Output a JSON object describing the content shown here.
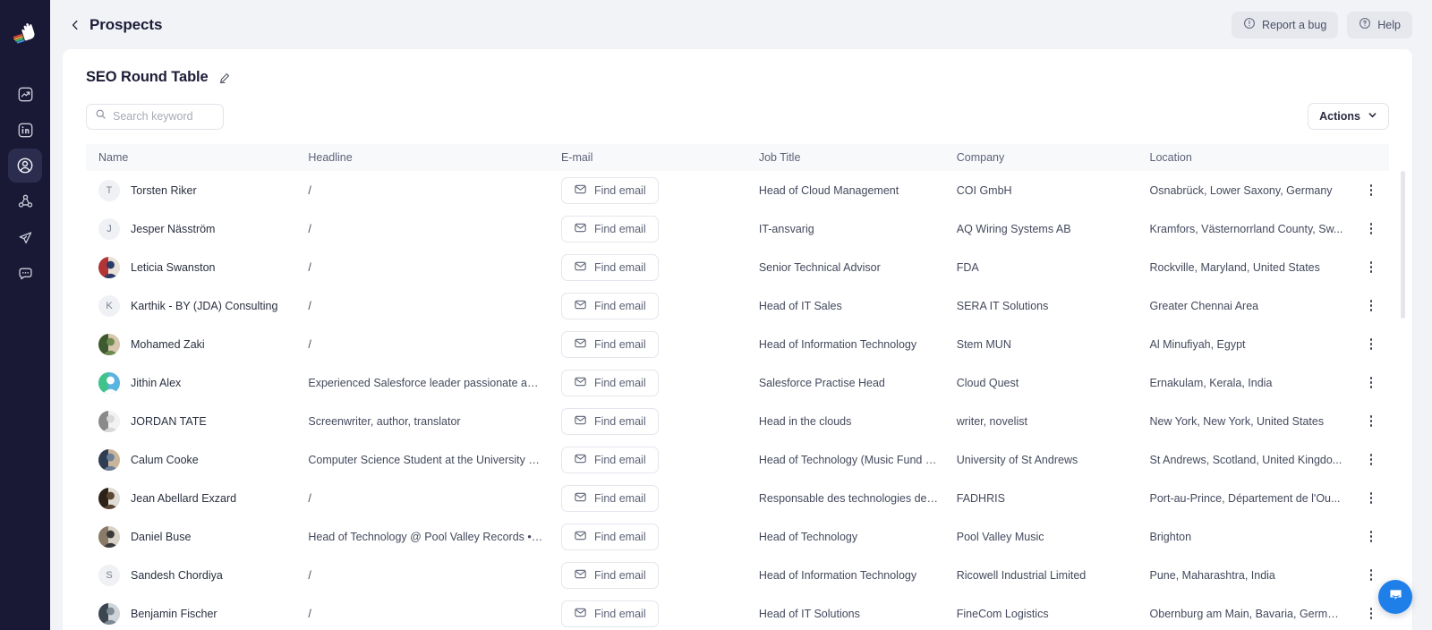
{
  "sidebar": {
    "logo_name": "hand-logo",
    "items": [
      {
        "name": "analytics",
        "icon": "trending-chart-icon",
        "active": false
      },
      {
        "name": "linkedin",
        "icon": "linkedin-icon",
        "active": false
      },
      {
        "name": "prospects",
        "icon": "user-circle-icon",
        "active": true
      },
      {
        "name": "network",
        "icon": "share-network-icon",
        "active": false
      },
      {
        "name": "campaigns",
        "icon": "paper-plane-icon",
        "active": false
      },
      {
        "name": "messages",
        "icon": "chat-bubble-icon",
        "active": false
      }
    ]
  },
  "topbar": {
    "back_label": "‹",
    "title": "Prospects",
    "report_bug_label": "Report a bug",
    "help_label": "Help"
  },
  "list": {
    "title": "SEO Round Table",
    "edit_tooltip": "Edit"
  },
  "search": {
    "placeholder": "Search keyword",
    "value": ""
  },
  "actions": {
    "label": "Actions",
    "caret": "▾"
  },
  "table": {
    "columns": [
      "Name",
      "Headline",
      "E-mail",
      "Job Title",
      "Company",
      "Location"
    ],
    "find_email_label": "Find email",
    "rows": [
      {
        "name": "Torsten Riker",
        "avatar_type": "initial",
        "initial": "T",
        "headline": "/",
        "email_action": "Find email",
        "job_title": "Head of Cloud Management",
        "company": "COI GmbH",
        "location": "Osnabrück, Lower Saxony, Germany"
      },
      {
        "name": "Jesper Näsström",
        "avatar_type": "initial",
        "initial": "J",
        "headline": "/",
        "email_action": "Find email",
        "job_title": "IT-ansvarig",
        "company": "AQ Wiring Systems AB",
        "location": "Kramfors, Västernorrland County, Sw..."
      },
      {
        "name": "Leticia Swanston",
        "avatar_type": "photo",
        "photo_colors": [
          "#2b3a66",
          "#b33434",
          "#e8e2d8"
        ],
        "headline": "/",
        "email_action": "Find email",
        "job_title": "Senior Technical Advisor",
        "company": "FDA",
        "location": "Rockville, Maryland, United States"
      },
      {
        "name": "Karthik - BY (JDA) Consulting",
        "avatar_type": "initial",
        "initial": "K",
        "headline": "/",
        "email_action": "Find email",
        "job_title": "Head of IT Sales",
        "company": "SERA IT Solutions",
        "location": "Greater Chennai Area"
      },
      {
        "name": "Mohamed Zaki",
        "avatar_type": "photo",
        "photo_colors": [
          "#6d8a4f",
          "#3d5a2e",
          "#d8c7ae"
        ],
        "headline": "/",
        "email_action": "Find email",
        "job_title": "Head of Information Technology",
        "company": "Stem MUN",
        "location": "Al Minufiyah, Egypt"
      },
      {
        "name": "Jithin Alex",
        "avatar_type": "photo",
        "photo_colors": [
          "#ffffff",
          "#3fc38a",
          "#5ab4e0"
        ],
        "headline": "Experienced Salesforce leader passionate about...",
        "email_action": "Find email",
        "job_title": "Salesforce Practise Head",
        "company": "Cloud Quest",
        "location": "Ernakulam, Kerala, India"
      },
      {
        "name": "JORDAN TATE",
        "avatar_type": "photo",
        "photo_colors": [
          "#d8d8d8",
          "#8a8a8a",
          "#f2f2f2"
        ],
        "headline": "Screenwriter, author, translator",
        "email_action": "Find email",
        "job_title": "Head in the clouds",
        "company": "writer, novelist",
        "location": "New York, New York, United States"
      },
      {
        "name": "Calum Cooke",
        "avatar_type": "photo",
        "photo_colors": [
          "#6b7f99",
          "#2f3d52",
          "#c9b69a"
        ],
        "headline": "Computer Science Student at the University of ...",
        "email_action": "Find email",
        "job_title": "Head of Technology (Music Fund Su...",
        "company": "University of St Andrews",
        "location": "St Andrews, Scotland, United Kingdo..."
      },
      {
        "name": "Jean Abellard Exzard",
        "avatar_type": "photo",
        "photo_colors": [
          "#5b4633",
          "#2d2218",
          "#e0ddd6"
        ],
        "headline": "/",
        "email_action": "Find email",
        "job_title": "Responsable des technologies de l'in...",
        "company": "FADHRIS",
        "location": "Port-au-Prince, Département de l'Ou..."
      },
      {
        "name": "Daniel Buse",
        "avatar_type": "photo",
        "photo_colors": [
          "#3a3a3a",
          "#8a7a68",
          "#d9d2c6"
        ],
        "headline": "Head of Technology @ Pool Valley Records • M...",
        "email_action": "Find email",
        "job_title": "Head of Technology",
        "company": "Pool Valley Music",
        "location": "Brighton"
      },
      {
        "name": "Sandesh Chordiya",
        "avatar_type": "initial",
        "initial": "S",
        "headline": "/",
        "email_action": "Find email",
        "job_title": "Head of Information Technology",
        "company": "Ricowell Industrial Limited",
        "location": "Pune, Maharashtra, India"
      },
      {
        "name": "Benjamin Fischer",
        "avatar_type": "photo",
        "photo_colors": [
          "#7e8b95",
          "#3c4650",
          "#cfd5d9"
        ],
        "headline": "/",
        "email_action": "Find email",
        "job_title": "Head of IT Solutions",
        "company": "FineCom Logistics",
        "location": "Obernburg am Main, Bavaria, Germany"
      }
    ]
  },
  "chat": {
    "name": "intercom-launcher"
  },
  "colors": {
    "sidebar_bg": "#191935",
    "page_bg": "#f1f3f7",
    "card_bg": "#ffffff",
    "accent_blue": "#1f7fe8",
    "text_dark": "#1c1c38",
    "text_muted": "#5d6377"
  }
}
